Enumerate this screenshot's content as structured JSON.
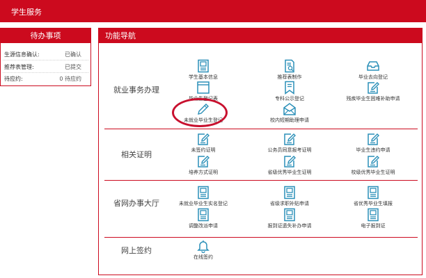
{
  "header": {
    "title": "学生服务"
  },
  "todo": {
    "title": "待办事项",
    "rows": [
      {
        "key": "生源信息确认:",
        "value": "已确认"
      },
      {
        "key": "推荐表管理:",
        "value": "已提交"
      },
      {
        "key": "待应约:",
        "value": "0 待应约"
      }
    ]
  },
  "nav": {
    "title": "功能导航",
    "sections": [
      {
        "title": "就业事务办理",
        "items": [
          {
            "label": "学生基本信息",
            "icon": "id-card-icon"
          },
          {
            "label": "推荐表制作",
            "icon": "document-search-icon"
          },
          {
            "label": "毕业去向登记",
            "icon": "inbox-icon"
          },
          {
            "label": "毕业生登记表",
            "icon": "form-icon"
          },
          {
            "label": "专科公示登记",
            "icon": "bookmark-icon"
          },
          {
            "label": "残疾毕业生困难补助申请",
            "icon": "edit-doc-icon"
          },
          {
            "label": "未就业毕业生登记",
            "icon": "pencil-icon"
          },
          {
            "label": "校内短期助理申请",
            "icon": "envelope-icon"
          }
        ]
      },
      {
        "title": "相关证明",
        "items": [
          {
            "label": "未签约证明",
            "icon": "edit-doc-icon"
          },
          {
            "label": "公务员同意报考证明",
            "icon": "edit-doc-icon"
          },
          {
            "label": "毕业生违约申请",
            "icon": "edit-doc-icon"
          },
          {
            "label": "培养方式证明",
            "icon": "edit-doc-icon"
          },
          {
            "label": "省级优秀毕业生证明",
            "icon": "edit-doc-icon"
          },
          {
            "label": "校级优秀毕业生证明",
            "icon": "edit-doc-icon"
          }
        ]
      },
      {
        "title": "省网办事大厅",
        "items": [
          {
            "label": "未就业毕业生实名登记",
            "icon": "id-card-icon"
          },
          {
            "label": "省级求职补贴申请",
            "icon": "id-card-icon"
          },
          {
            "label": "省优秀毕业生填报",
            "icon": "id-card-icon"
          },
          {
            "label": "调整改派申请",
            "icon": "id-card-icon"
          },
          {
            "label": "报到证遗失补办申请",
            "icon": "id-card-icon"
          },
          {
            "label": "电子报到证",
            "icon": "id-card-icon"
          }
        ]
      },
      {
        "title": "网上签约",
        "items": [
          {
            "label": "在线签约",
            "icon": "bell-icon"
          }
        ]
      }
    ]
  },
  "colors": {
    "brand": "#cc0a1e",
    "icon": "#2a8fb8",
    "highlight": "#c8102e"
  }
}
